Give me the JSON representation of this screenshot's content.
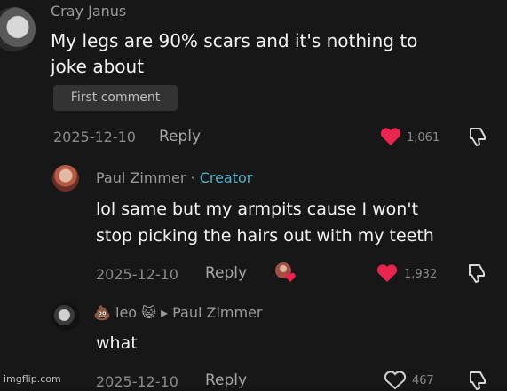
{
  "comments": [
    {
      "author": "Cray Janus",
      "text_line1": "My legs are 90% scars and it's nothing to",
      "text_line2": "joke about",
      "badge": "First comment",
      "date": "2025-12-10",
      "reply_label": "Reply",
      "likes": "1,061",
      "liked": true
    },
    {
      "author": "Paul Zimmer",
      "separator": "·",
      "role": "Creator",
      "text_line1": "lol same but my armpits cause I won't",
      "text_line2": "stop picking the hairs out with my teeth",
      "date": "2025-12-10",
      "reply_label": "Reply",
      "likes": "1,932",
      "liked": true
    },
    {
      "author_prefix_emoji": "💩",
      "author": "leo",
      "author_suffix_emoji": "😺",
      "reply_to_arrow": "▸",
      "reply_to": "Paul Zimmer",
      "text_line1": "what",
      "date": "2025-12-10",
      "reply_label": "Reply",
      "likes": "467",
      "liked": false
    }
  ],
  "watermark": "imgflip.com",
  "colors": {
    "background": "#171717",
    "like_active": "#e8244f",
    "creator": "#4fb3c8"
  },
  "icons": [
    "heart-icon",
    "dislike-icon",
    "creator-liked-avatar"
  ]
}
